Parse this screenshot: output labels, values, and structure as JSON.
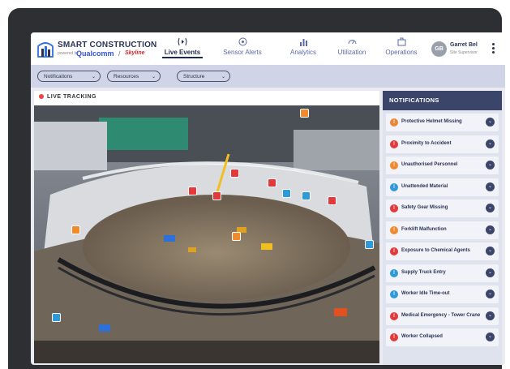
{
  "app": {
    "title": "SMART CONSTRUCTION",
    "powered_by": "powered by",
    "partner1": "Qualcomm",
    "separator": "/",
    "partner2": "Skyline"
  },
  "nav": {
    "tabs": [
      {
        "label": "Live Events",
        "icon": "broadcast-icon",
        "active": true
      },
      {
        "label": "Sensor Alerts",
        "icon": "sensor-icon",
        "active": false
      },
      {
        "label": "Analytics",
        "icon": "bar-chart-icon",
        "active": false
      },
      {
        "label": "Utilization",
        "icon": "gauge-icon",
        "active": false
      },
      {
        "label": "Operations",
        "icon": "briefcase-icon",
        "active": false
      }
    ]
  },
  "user": {
    "initials": "GB",
    "name": "Garret Bel",
    "role": "Site Supervisor"
  },
  "filters": [
    {
      "label": "Notifications"
    },
    {
      "label": "Resources"
    },
    {
      "label": "Structure"
    }
  ],
  "live": {
    "label": "LIVE TRACKING"
  },
  "notifications": {
    "title": "NOTIFICATIONS",
    "items": [
      {
        "label": "Protective Helmet Missing",
        "color": "#e8863a",
        "icon": "helmet-icon"
      },
      {
        "label": "Proximity to Accident",
        "color": "#e23a3a",
        "icon": "warning-icon"
      },
      {
        "label": "Unauthorised Personnel",
        "color": "#f08a2c",
        "icon": "person-icon"
      },
      {
        "label": "Unattended Material",
        "color": "#2f9ad8",
        "icon": "box-icon"
      },
      {
        "label": "Safety Gear Missing",
        "color": "#e23a3a",
        "icon": "vest-icon"
      },
      {
        "label": "Forklift Malfunction",
        "color": "#f08a2c",
        "icon": "forklift-icon"
      },
      {
        "label": "Exposure to Chemical Agents",
        "color": "#e23a3a",
        "icon": "chemical-icon"
      },
      {
        "label": "Supply Truck Entry",
        "color": "#2f9ad8",
        "icon": "truck-icon"
      },
      {
        "label": "Worker Idle Time-out",
        "color": "#2f9ad8",
        "icon": "clock-icon"
      },
      {
        "label": "Medical Emergency - Tower Crane",
        "color": "#e23a3a",
        "icon": "medical-icon"
      },
      {
        "label": "Worker Collapsed",
        "color": "#e23a3a",
        "icon": "alert-icon"
      }
    ]
  },
  "colors": {
    "accent": "#3b4569",
    "danger": "#e23a3a",
    "warning": "#f08a2c",
    "info": "#2f9ad8"
  }
}
